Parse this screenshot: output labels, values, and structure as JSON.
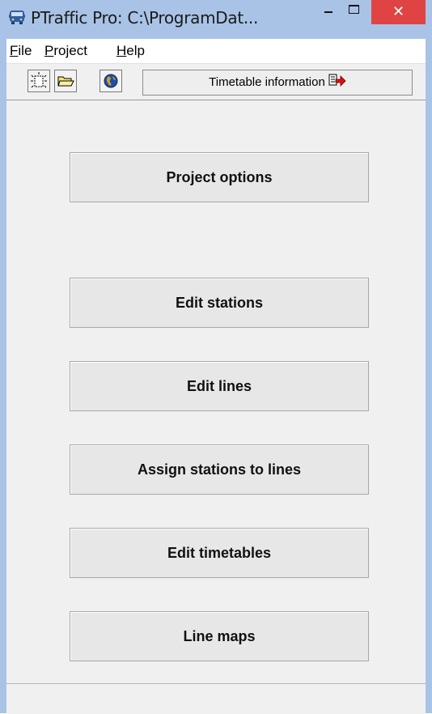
{
  "window": {
    "title": "PTraffic Pro:  C:\\ProgramDat...",
    "close_label": "✕",
    "accent_title_bg": "#a8c3e6",
    "close_bg": "#e04343"
  },
  "menu": {
    "items": [
      {
        "accel": "F",
        "rest": "ile"
      },
      {
        "accel": "P",
        "rest": "roject"
      },
      {
        "accel": "H",
        "rest": "elp"
      }
    ]
  },
  "toolbar": {
    "icons": [
      "new-document-icon",
      "open-folder-icon",
      "globe-icon"
    ],
    "timetable_label": "Timetable information"
  },
  "main": {
    "buttons": [
      "Project options",
      "Edit stations",
      "Edit lines",
      "Assign stations to lines",
      "Edit timetables",
      "Line maps"
    ]
  }
}
